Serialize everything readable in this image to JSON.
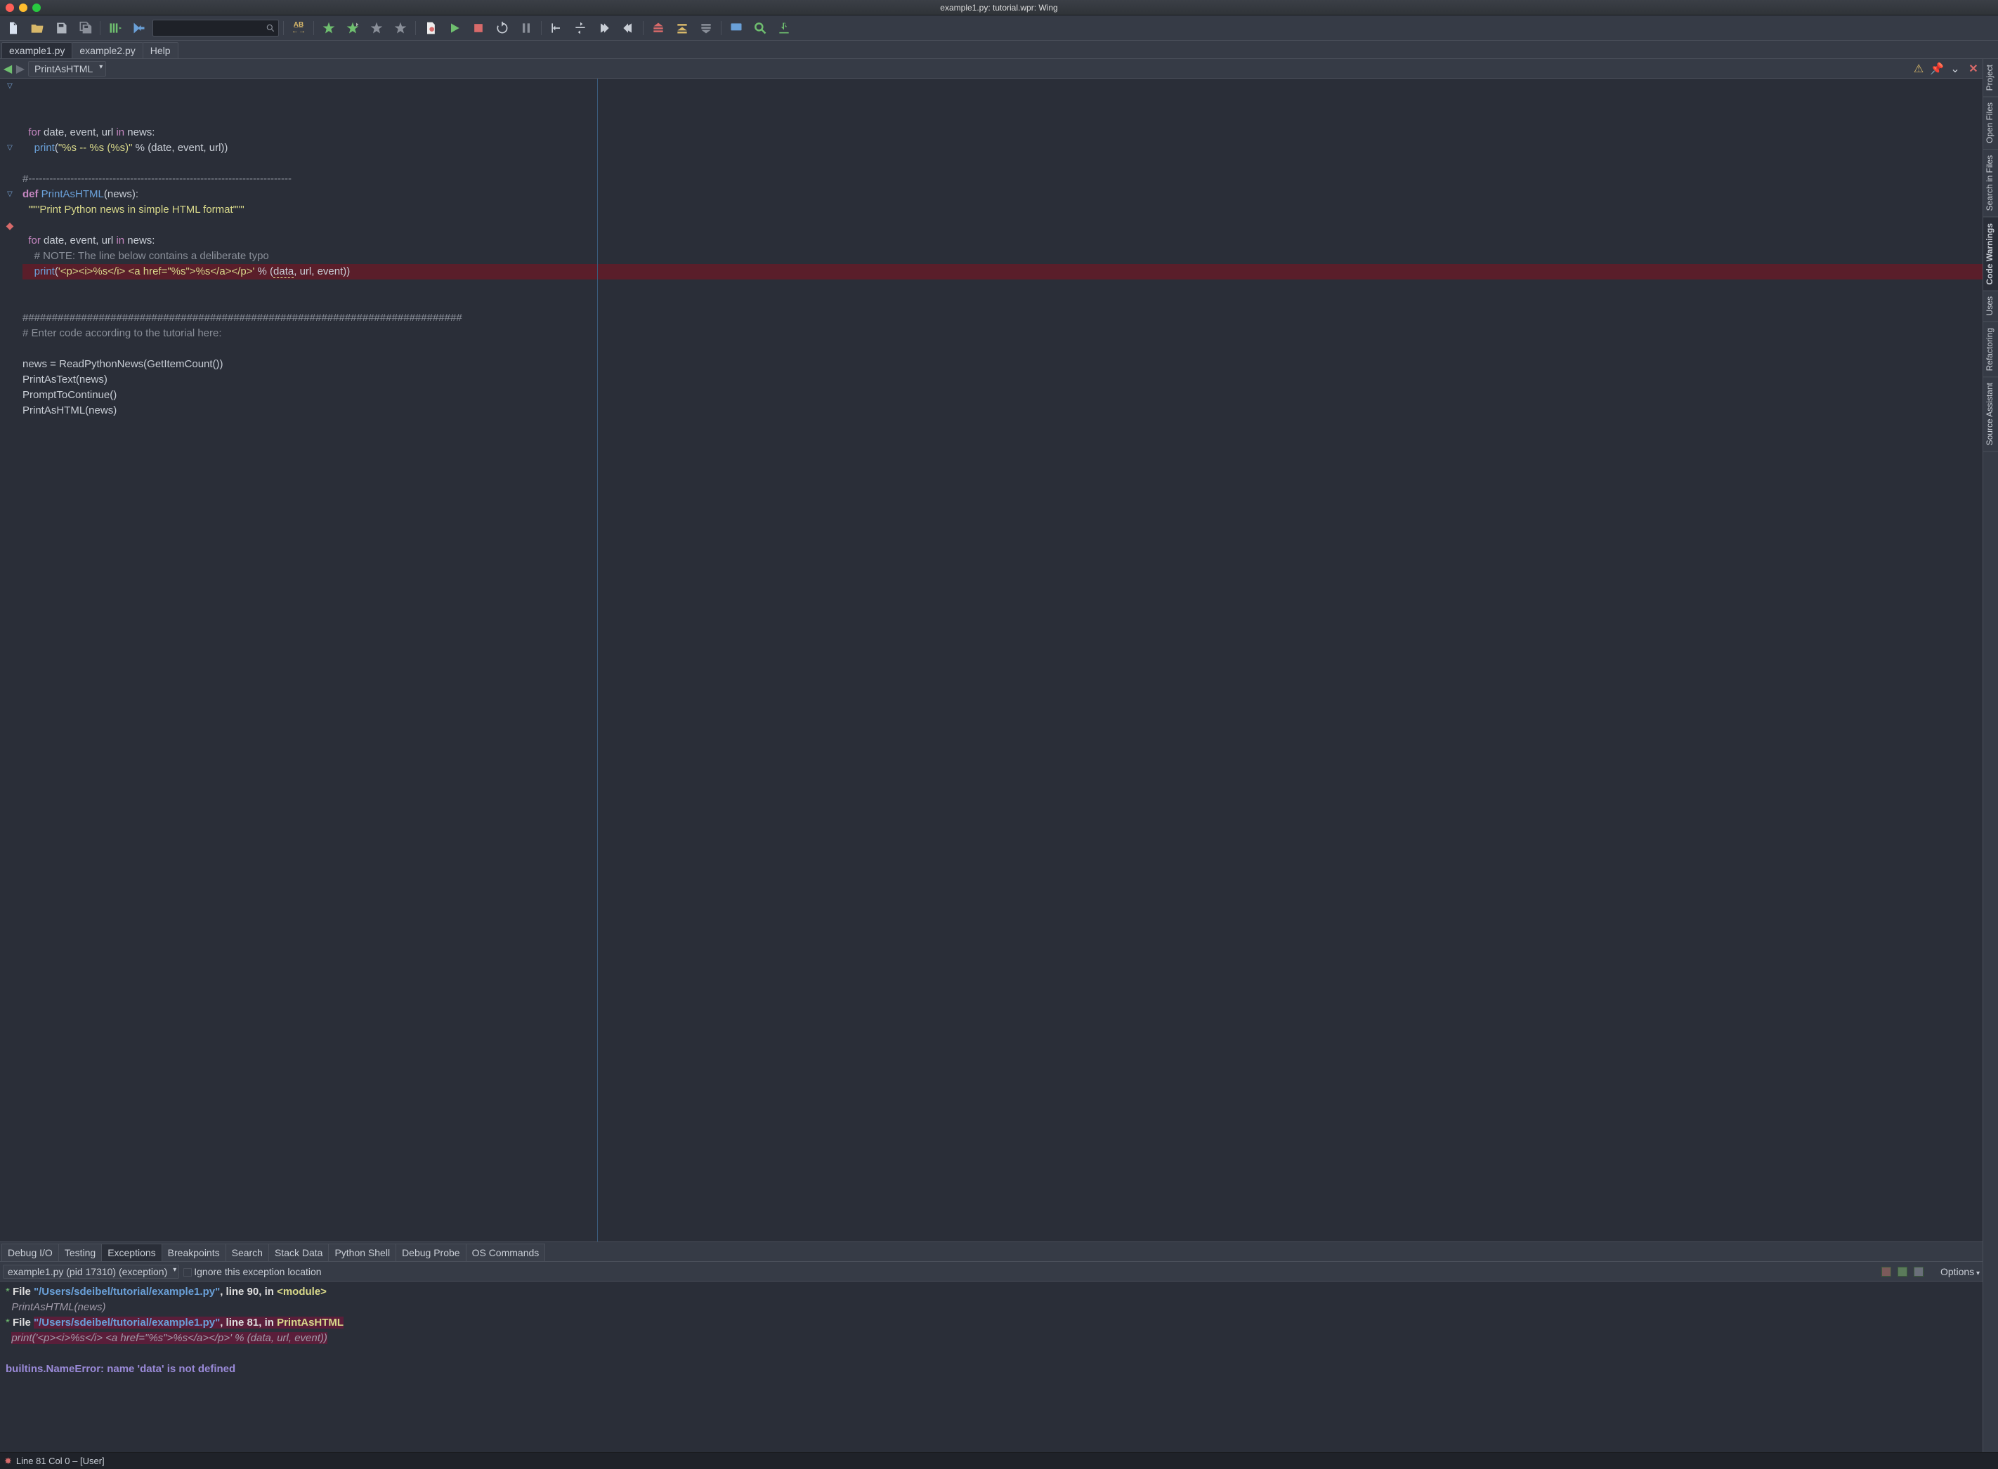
{
  "titlebar": {
    "title": "example1.py: tutorial.wpr: Wing"
  },
  "filetabs": [
    "example1.py",
    "example2.py",
    "Help"
  ],
  "filetabs_active": 0,
  "crumb": {
    "function": "PrintAsHTML"
  },
  "editor": {
    "lines": [
      {
        "fold": "▽",
        "raw": "  <span class='tok-kw'>for</span> date, event, url <span class='tok-kw'>in</span> news:"
      },
      {
        "fold": "",
        "raw": "    <span class='tok-fn'>print</span>(<span class='tok-str'>\"%s -- %s (%s)\"</span> % (date, event, url))"
      },
      {
        "fold": "",
        "raw": ""
      },
      {
        "fold": "",
        "raw": "<span class='tok-cmt'>#---------------------------------------------------------------------------</span>"
      },
      {
        "fold": "▽",
        "raw": "<span class='tok-def'>def</span> <span class='tok-fn'>PrintAsHTML</span>(news):"
      },
      {
        "fold": "",
        "raw": "  <span class='tok-str'>\"\"\"Print Python news in simple HTML format\"\"\"</span>"
      },
      {
        "fold": "",
        "raw": ""
      },
      {
        "fold": "▽",
        "raw": "  <span class='tok-kw'>for</span> date, event, url <span class='tok-kw'>in</span> news:"
      },
      {
        "fold": "",
        "raw": "    <span class='tok-cmt'># NOTE: The line below contains a deliberate typo</span>"
      },
      {
        "fold": "►",
        "raw": "    <span class='tok-fn'>print</span>(<span class='tok-str'>'&lt;p&gt;&lt;i&gt;%s&lt;/i&gt; &lt;a href=\"%s\"&gt;%s&lt;/a&gt;&lt;/p&gt;'</span> % (<span class='tok-underline'>data</span>, url, event))",
        "err": true,
        "bp": true
      },
      {
        "fold": "",
        "raw": ""
      },
      {
        "fold": "",
        "raw": ""
      },
      {
        "fold": "",
        "raw": "<span class='tok-cmt'>###########################################################################</span>"
      },
      {
        "fold": "",
        "raw": "<span class='tok-cmt'># Enter code according to the tutorial here:</span>"
      },
      {
        "fold": "",
        "raw": ""
      },
      {
        "fold": "",
        "raw": "news = ReadPythonNews(GetItemCount())"
      },
      {
        "fold": "",
        "raw": "PrintAsText(news)"
      },
      {
        "fold": "",
        "raw": "PromptToContinue()"
      },
      {
        "fold": "",
        "raw": "PrintAsHTML(news)"
      },
      {
        "fold": "",
        "raw": ""
      }
    ]
  },
  "right_tabs": [
    "Project",
    "Open Files",
    "Search in Files",
    "Code Warnings",
    "Uses",
    "Refactoring",
    "Source Assistant"
  ],
  "right_active": 3,
  "bottom_tabs": [
    "Debug I/O",
    "Testing",
    "Exceptions",
    "Breakpoints",
    "Search",
    "Stack Data",
    "Python Shell",
    "Debug Probe",
    "OS Commands"
  ],
  "bottom_active": 2,
  "exception_toolbar": {
    "process": "example1.py (pid 17310) (exception)",
    "checkbox_label": "Ignore this exception location",
    "options": "Options"
  },
  "traceback": {
    "frames": [
      {
        "file_label": "File ",
        "path": "\"/Users/sdeibel/tutorial/example1.py\"",
        "rest": ", line 90, in ",
        "func": "<module>",
        "call": "PrintAsHTML(news)",
        "hl": false
      },
      {
        "file_label": "File ",
        "path": "\"/Users/sdeibel/tutorial/example1.py\"",
        "rest": ", line 81, in ",
        "func": "PrintAsHTML",
        "call": "print('<p><i>%s</i> <a href=\"%s\">%s</a></p>' % (data, url, event))",
        "hl": true
      }
    ],
    "exception": "builtins.NameError: name 'data' is not defined"
  },
  "statusbar": {
    "text": "Line 81 Col 0 – [User]"
  }
}
